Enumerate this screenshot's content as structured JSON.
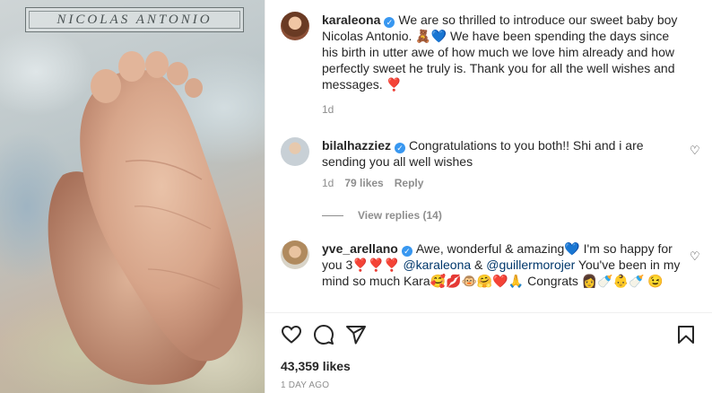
{
  "photo": {
    "caption_plate": "NICOLAS ANTONIO"
  },
  "caption": {
    "username": "karaleona",
    "text": "We are so thrilled to introduce our sweet baby boy Nicolas Antonio. 🧸💙 We have been spending the days since his birth in utter awe of how much we love him already and how perfectly sweet he truly is. Thank you for all the well wishes and messages. ❣️",
    "age": "1d"
  },
  "comments": [
    {
      "username": "bilalhazziez",
      "text": "Congratulations to you both!! Shi and i are sending you all well wishes",
      "age": "1d",
      "likes": "79 likes",
      "reply_label": "Reply",
      "view_replies": "View replies (14)"
    },
    {
      "username": "yve_arellano",
      "text_before": "Awe, wonderful & amazing💙 I'm so happy for you 3❣️❣️❣️ ",
      "mention1": "@karaleona",
      "text_mid": " & ",
      "mention2": "@guillermorojer",
      "text_after": " You've been in my mind so much Kara🥰💋🐵🤗❤️🙏 Congrats 👩🍼👶🍼 😉"
    }
  ],
  "likes_count": "43,359 likes",
  "timestamp": "1 DAY AGO",
  "icons": {
    "verified": "verified-badge-icon",
    "like": "heart-icon",
    "comment": "comment-icon",
    "share": "paper-plane-icon",
    "save": "bookmark-icon"
  },
  "colors": {
    "verified_blue": "#3897f0",
    "text": "#262626",
    "secondary": "#8e8e8e",
    "mention": "#00376b"
  }
}
